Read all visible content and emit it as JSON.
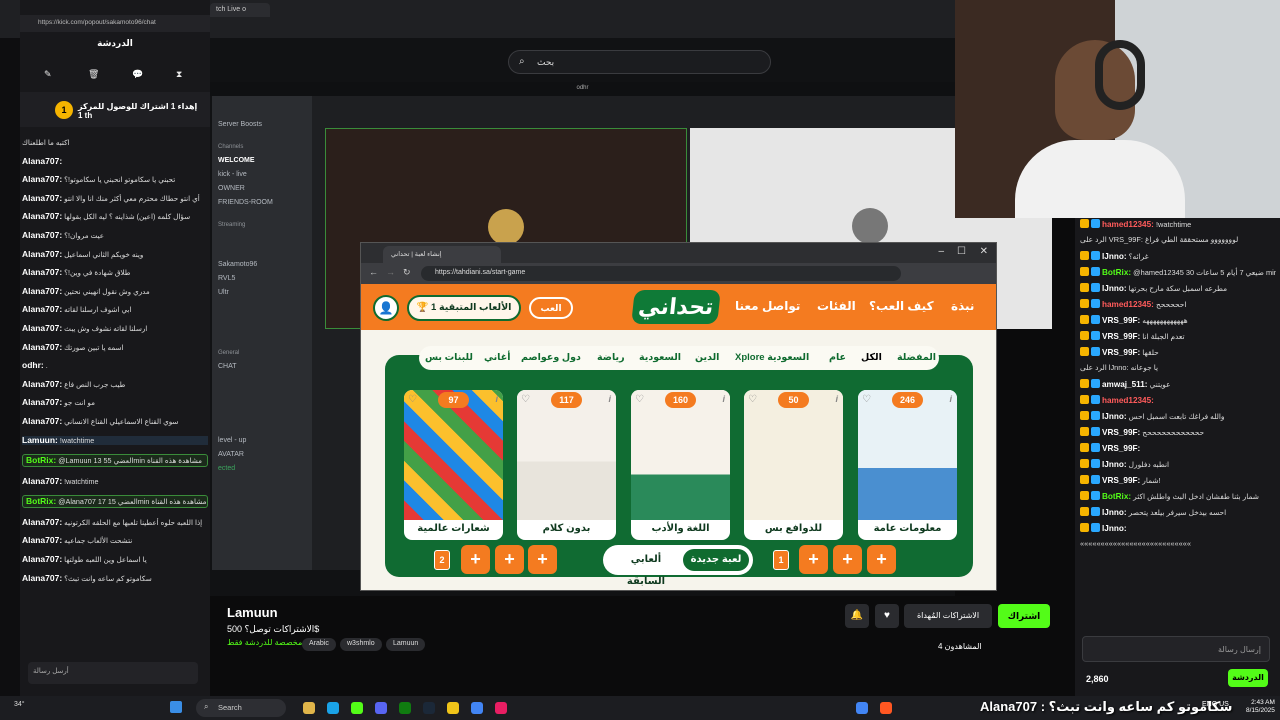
{
  "browser": {
    "url": "https://kick.com/popout/sakamoto96/chat",
    "tab_label": "tch Live o"
  },
  "kick": {
    "search_placeholder": "بحث",
    "stream_bar_label": "odhr",
    "streamer_name": "Lamuun",
    "stream_title": "الاشتراكات توصل؟ 500$",
    "stream_subtitle": "مخصصة للدردشة فقط",
    "tags": [
      "Arabic",
      "w3shmlo",
      "Lamuun"
    ],
    "follow_label": "اشتراك",
    "subs_label": "الاشتراكات المُهداة",
    "viewers_label": "المشاهدون 4"
  },
  "discord": {
    "items": [
      "Server Boosts",
      "Channels",
      "WELCOME",
      "kick - live",
      "OWNER",
      "FRIENDS-ROOM",
      "Streaming",
      "Sakamoto96",
      "RVL5",
      "Ultr",
      "General",
      "CHAT",
      "level - up",
      "AVATAR",
      "ected"
    ]
  },
  "left_chat": {
    "title": "الدردشة",
    "goal_number": "1",
    "goal_text": "إهداء 1 اشتراك للوصول للمركز 1 th",
    "messages": [
      {
        "user": "",
        "text": "اكتبه ما اطلعناك"
      },
      {
        "user": "Alana707:",
        "text": ""
      },
      {
        "user": "Alana707:",
        "text": "تحبني يا سكاموتو انحبني يا سكاموتو!؟"
      },
      {
        "user": "Alana707:",
        "text": "أي انتو حطاك محترم معي أكثر منك انا والا انتو"
      },
      {
        "user": "Alana707:",
        "text": "سؤال كلمه (اعين) شذاينه ؟ ليه الكل بقولها"
      },
      {
        "user": "Alana707:",
        "text": "عيت مروان!؟"
      },
      {
        "user": "Alana707:",
        "text": "وينه خويكم الثاني اسماعيل"
      },
      {
        "user": "Alana707:",
        "text": "طلاق شهادة في وين!؟"
      },
      {
        "user": "Alana707:",
        "text": "مدري وش نقول انهيني نحتين"
      },
      {
        "user": "Alana707:",
        "text": "ابي اشوف ارسلنا لقاته"
      },
      {
        "user": "Alana707:",
        "text": "ارسلنا لقاته نشوف وش يبث"
      },
      {
        "user": "Alana707:",
        "text": "اسمه يا تبين صورتك"
      },
      {
        "user": "odhr:",
        "text": "."
      },
      {
        "user": "Alana707:",
        "text": "طيب جرب النص فاع"
      },
      {
        "user": "Alana707:",
        "text": "مو انت جو"
      },
      {
        "user": "Alana707:",
        "text": "سوي القناع الاسماعيلي القناع الانساني"
      },
      {
        "user": "Lamuun:",
        "text": "!watchtime"
      },
      {
        "user": "BotRix:",
        "text": "@Lamuun 13 العضي 55min مشاهدة هذه القناة"
      },
      {
        "user": "Alana707:",
        "text": "!watchtime"
      },
      {
        "user": "BotRix:",
        "text": "@Alana707 17 العضي 15min مشاهدة هذه القناة"
      },
      {
        "user": "Alana707:",
        "text": "إذا اللعبه حلوه أعطينا تلعبها مع الحلقه الكرتونيه"
      },
      {
        "user": "Alana707:",
        "text": "نتشحت الألعاب جماعيه"
      },
      {
        "user": "Alana707:",
        "text": "يا اسماعل وين اللعبه طولتها"
      },
      {
        "user": "Alana707:",
        "text": "سكاموتو كم ساعه وانت تبث؟"
      }
    ],
    "input_placeholder": "أرسل رسالة"
  },
  "game": {
    "tab_title": "إنشاء لعبة | تحداني",
    "url": "https://tahdiani.sa/start-game",
    "logo": "تحداني",
    "nav_links": [
      "نبذة",
      "كيف العب؟",
      "الفئات",
      "تواصل معنا"
    ],
    "play_label": "العب",
    "remaining_label": "الألعاب المتبقية 1",
    "categories": [
      "المفضلة",
      "الكل",
      "عام",
      "Xplore السعودية",
      "الدين",
      "السعودية",
      "رياضة",
      "دول وعواصم",
      "أغاني",
      "للبنات بس"
    ],
    "cards": [
      {
        "name": "معلومات عامة",
        "count": "246"
      },
      {
        "name": "للدوافع بس",
        "count": "50"
      },
      {
        "name": "اللغة والأدب",
        "count": "160"
      },
      {
        "name": "بدون كلام",
        "count": "117"
      },
      {
        "name": "شعارات عالمية",
        "count": "97"
      }
    ],
    "new_game_label": "لعبة جديدة",
    "prev_games_label": "ألعابي السابقة",
    "left_team_number": "2",
    "right_team_number": "1",
    "plus_label": "+"
  },
  "right_chat": {
    "messages": [
      {
        "user": "hamed12345:",
        "text": "!watchtime",
        "type": "red"
      },
      {
        "user": "",
        "text": "الرد على VRS_99F: لووووووو مستحققة الطي فراغ",
        "type": "plain"
      },
      {
        "user": "lJnno:",
        "text": "غرائه؟",
        "type": "u"
      },
      {
        "user": "BotRix:",
        "text": "@hamed12345 ضيعي 7 أيام 5 ساعات 30 min مشاهدة هذه القناة",
        "type": "bot"
      },
      {
        "user": "lJnno:",
        "text": "مطرعه اسمبل سكة مارح بحرتها",
        "type": "u"
      },
      {
        "user": "hamed12345:",
        "text": "احححححح",
        "type": "red"
      },
      {
        "user": "VRS_99F:",
        "text": "ههههههههههههه",
        "type": "u"
      },
      {
        "user": "VRS_99F:",
        "text": "تعدم الجبلة انا",
        "type": "u"
      },
      {
        "user": "VRS_99F:",
        "text": "حلقها",
        "type": "u"
      },
      {
        "user": "",
        "text": "الرد على lJnno: يا جوعانه",
        "type": "plain"
      },
      {
        "user": "amwaj_511:",
        "text": "عويتني",
        "type": "u"
      },
      {
        "user": "hamed12345:",
        "text": "",
        "type": "red"
      },
      {
        "user": "lJnno:",
        "text": "والله فراغك تابعت اسمبل احس",
        "type": "u"
      },
      {
        "user": "VRS_99F:",
        "text": "ححححححححححححح",
        "type": "u"
      },
      {
        "user": "VRS_99F:",
        "text": "",
        "type": "u"
      },
      {
        "user": "lJnno:",
        "text": "انطبه دفلورل",
        "type": "u"
      },
      {
        "user": "VRS_99F:",
        "text": "شمار!",
        "type": "u"
      },
      {
        "user": "BotRix:",
        "text": "شمار بثنا طفشان ادخل البث واطلش اكثر",
        "type": "bot"
      },
      {
        "user": "lJnno:",
        "text": "احسه بيدخل سيرفر بيلعد يتحصر",
        "type": "u"
      },
      {
        "user": "lJnno:",
        "text": "",
        "type": "u"
      },
      {
        "user": "",
        "text": "«««««««««««««««««««««««««««",
        "type": "plain"
      }
    ],
    "input_placeholder": "إرسال رسالة",
    "points": "2,860",
    "send_label": "الدردشة"
  },
  "taskbar": {
    "weather": "34°",
    "search_label": "Search",
    "lang": "ENG US",
    "time": "2:43 AM",
    "date": "8/15/2025",
    "marquee": "Alana707 : سكاموتو كم ساعه وانت تبث؟"
  },
  "colors": {
    "kick_green": "#53fc18",
    "game_orange": "#f47b20",
    "game_green": "#106b32"
  }
}
